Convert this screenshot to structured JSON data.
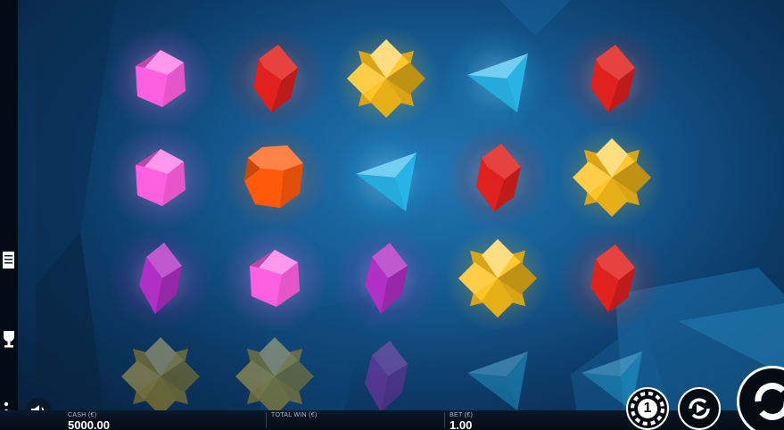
{
  "bottom_bar": {
    "cash_label": "CASH (€)",
    "cash_value": "5000.00",
    "total_win_label": "TOTAL WIN (€)",
    "total_win_value": "",
    "bet_label": "BET (€)",
    "bet_value": "1.00"
  },
  "controls": {
    "bet_chip_label": "1",
    "paytable_icon": "paytable-icon",
    "trophy_icon": "trophy-icon",
    "menu_icon": "menu-dots-icon",
    "sound_icon": "speaker-icon",
    "autoplay_icon": "autoplay-icon",
    "spin_icon": "spin-icon"
  },
  "reels": {
    "rows": [
      [
        "pink-gem",
        "red-gem",
        "yellow-star-gem",
        "blue-triangle-gem",
        "red-gem"
      ],
      [
        "pink-gem",
        "orange-gem",
        "blue-triangle-gem",
        "red-gem",
        "yellow-star-gem"
      ],
      [
        "purple-gem",
        "pink-gem",
        "purple-gem",
        "yellow-star-gem",
        "red-gem"
      ],
      [
        "yellow-star-gem",
        "yellow-star-gem",
        "purple-gem",
        "blue-triangle-gem",
        "blue-triangle-gem"
      ]
    ],
    "faded_row": 3
  },
  "colors": {
    "background": "#155a92",
    "pink": "#ff5fe0",
    "red": "#e0211e",
    "yellow": "#ffc21a",
    "blue": "#27b3e6",
    "orange": "#ff5a0a",
    "purple": "#b02fc4"
  }
}
